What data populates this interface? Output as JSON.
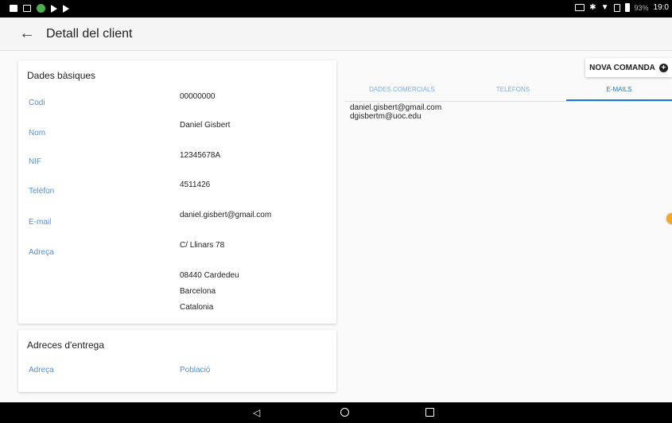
{
  "status_bar": {
    "battery_pct": "93%",
    "time": "19:0",
    "left_icons": [
      "video-icon",
      "screen-icon",
      "app-icon",
      "play-icon",
      "play-outline-icon"
    ],
    "right_icons": [
      "cast-icon",
      "bluetooth-icon",
      "wifi-icon",
      "sim-icon",
      "battery-icon"
    ]
  },
  "appbar": {
    "back_icon": "arrow-left-icon",
    "title": "Detall del client"
  },
  "basic": {
    "title": "Dades bàsiques",
    "labels": {
      "codi": "Codi",
      "nom": "Nom",
      "nif": "NIF",
      "telefon": "Telèfon",
      "email": "E-mail",
      "adreca": "Adreça"
    },
    "values": {
      "codi": "00000000",
      "nom": "Daniel Gisbert",
      "nif": "12345678A",
      "telefon": "4511426",
      "email": "daniel.gisbert@gmail.com",
      "adreca": "C/ Llinars 78",
      "cp_city": "08440 Cardedeu",
      "province": "Barcelona",
      "region": "Catalonia"
    }
  },
  "delivery": {
    "title": "Adreces d'entrega",
    "col_adreca": "Adreça",
    "col_poblacio": "Població"
  },
  "actions": {
    "nova_comanda": "NOVA COMANDA",
    "plus_glyph": "+"
  },
  "tabs": [
    "DADES COMERCIALS",
    "TELÈFONS",
    "E-MAILS"
  ],
  "active_tab": "E-MAILS",
  "emails": [
    "daniel.gisbert@gmail.com",
    "dgisbertm@uoc.edu"
  ],
  "navbar": {
    "icons": [
      "back-triangle-icon",
      "home-circle-icon",
      "recents-square-icon"
    ]
  },
  "colors": {
    "label_blue": "#4a90e2",
    "accent": "#1976d2",
    "fab_orange": "#f5a623"
  }
}
